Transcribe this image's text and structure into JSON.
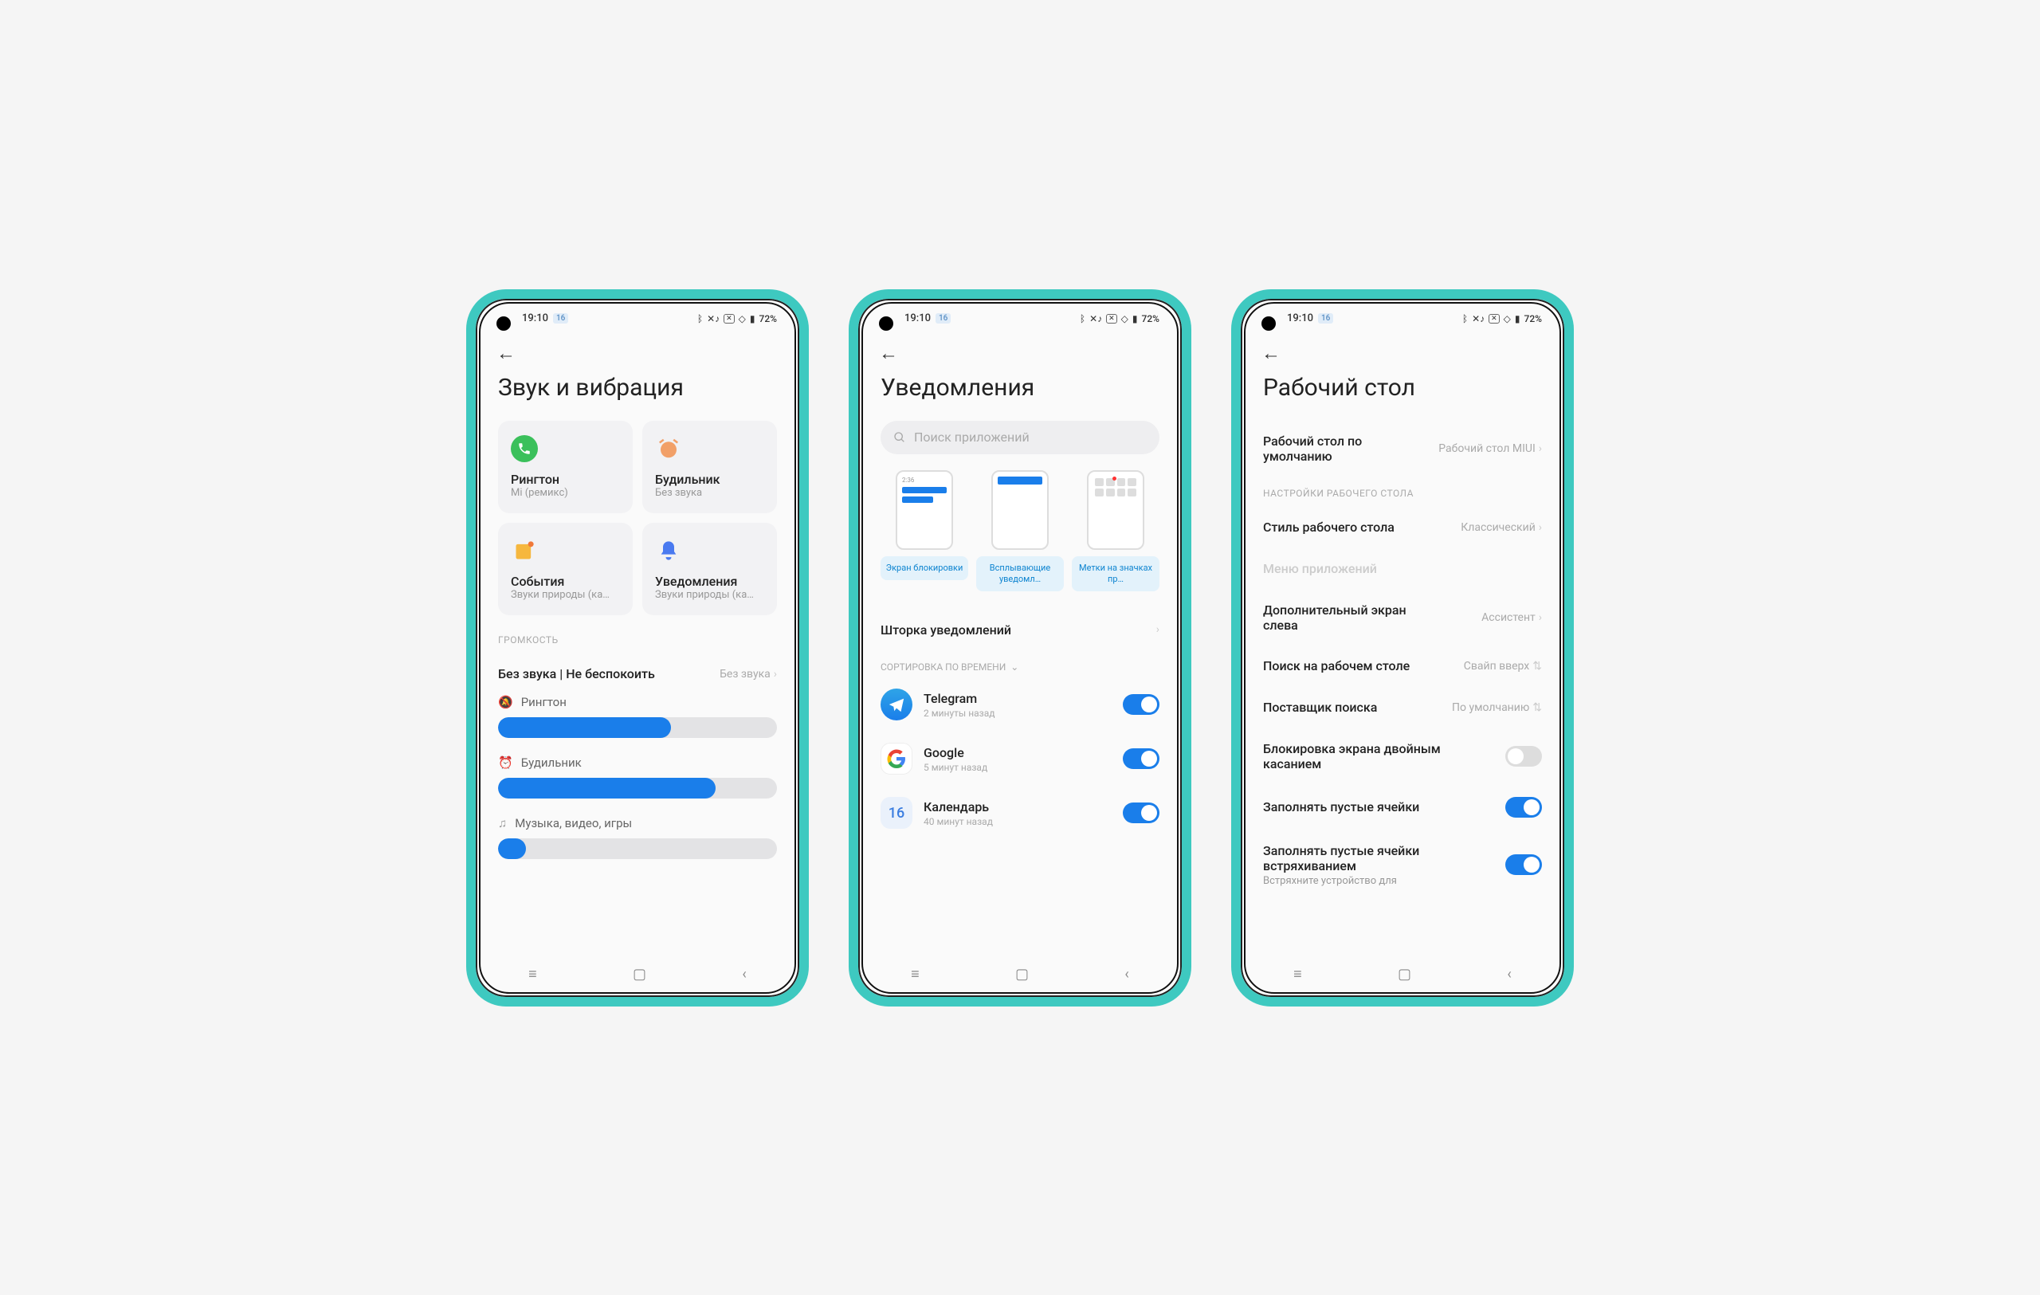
{
  "statusbar": {
    "time": "19:10",
    "badge": "16",
    "battery": "72%"
  },
  "sound": {
    "title": "Звук и вибрация",
    "cards": [
      {
        "title": "Рингтон",
        "sub": "Mi (ремикс)"
      },
      {
        "title": "Будильник",
        "sub": "Без звука"
      },
      {
        "title": "События",
        "sub": "Звуки природы (ка…"
      },
      {
        "title": "Уведомления",
        "sub": "Звуки природы (ка…"
      }
    ],
    "volume_label": "ГРОМКОСТЬ",
    "silent_row": {
      "label": "Без звука | Не беспокоить",
      "value": "Без звука"
    },
    "sliders": [
      {
        "label": "Рингтон",
        "value": 62
      },
      {
        "label": "Будильник",
        "value": 78
      },
      {
        "label": "Музыка, видео, игры",
        "value": 10
      }
    ]
  },
  "notif": {
    "title": "Уведомления",
    "search_placeholder": "Поиск приложений",
    "types": [
      "Экран блокировки",
      "Всплывающие уведомл…",
      "Метки на значках пр…"
    ],
    "shade_row": "Шторка уведомлений",
    "sort_label": "СОРТИРОВКА ПО ВРЕМЕНИ",
    "apps": [
      {
        "name": "Telegram",
        "time": "2 минуты назад",
        "on": true
      },
      {
        "name": "Google",
        "time": "5 минут назад",
        "on": true
      },
      {
        "name": "Календарь",
        "time": "40 минут назад",
        "on": true
      }
    ],
    "calendar_badge": "16"
  },
  "desktop": {
    "title": "Рабочий стол",
    "rows": [
      {
        "label": "Рабочий стол по умолчанию",
        "value": "Рабочий стол MIUI",
        "kind": "link"
      },
      null,
      {
        "section": "НАСТРОЙКИ РАБОЧЕГО СТОЛА"
      },
      {
        "label": "Стиль рабочего стола",
        "value": "Классический",
        "kind": "link"
      },
      {
        "label": "Меню приложений",
        "kind": "disabled"
      },
      {
        "label": "Дополнительный экран слева",
        "value": "Ассистент",
        "kind": "link"
      },
      {
        "label": "Поиск на рабочем столе",
        "value": "Свайп вверх",
        "kind": "updown"
      },
      {
        "label": "Поставщик поиска",
        "value": "По умолчанию",
        "kind": "updown"
      },
      {
        "label": "Блокировка экрана двойным касанием",
        "kind": "toggle",
        "on": false
      },
      {
        "label": "Заполнять пустые ячейки",
        "kind": "toggle",
        "on": true
      },
      {
        "label": "Заполнять пустые ячейки встряхиванием",
        "sublabel": "Встряхните устройство для",
        "kind": "toggle",
        "on": true
      }
    ]
  }
}
